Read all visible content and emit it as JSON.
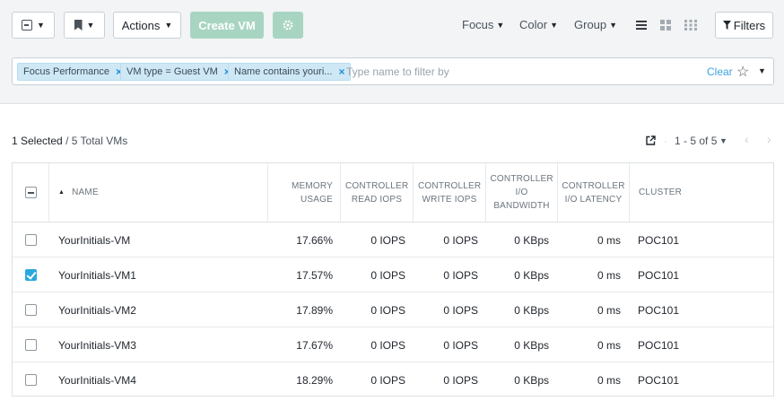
{
  "toolbar": {
    "actions_label": "Actions",
    "create_vm_label": "Create VM",
    "focus_label": "Focus",
    "color_label": "Color",
    "group_label": "Group",
    "filters_label": "Filters"
  },
  "filter_bar": {
    "chips": [
      {
        "label": "Focus Performance"
      },
      {
        "label": "VM type = Guest VM"
      },
      {
        "label": "Name contains youri..."
      }
    ],
    "chip_close": "×",
    "placeholder": "Type name to filter by",
    "clear_label": "Clear"
  },
  "summary": {
    "selected": "1 Selected",
    "total": "/ 5 Total VMs"
  },
  "pagination": {
    "range": "1 - 5 of 5"
  },
  "table": {
    "columns": [
      {
        "label": "NAME",
        "sort": "ascending"
      },
      {
        "label": "MEMORY USAGE"
      },
      {
        "label": "CONTROLLER READ IOPS"
      },
      {
        "label": "CONTROLLER WRITE IOPS"
      },
      {
        "label": "CONTROLLER I/O BANDWIDTH"
      },
      {
        "label": "CONTROLLER I/O LATENCY"
      },
      {
        "label": "CLUSTER"
      }
    ],
    "rows": [
      {
        "checked": false,
        "name": "YourInitials-VM",
        "memory": "17.66%",
        "read_iops": "0 IOPS",
        "write_iops": "0 IOPS",
        "bandwidth": "0 KBps",
        "latency": "0 ms",
        "cluster": "POC101"
      },
      {
        "checked": true,
        "name": "YourInitials-VM1",
        "memory": "17.57%",
        "read_iops": "0 IOPS",
        "write_iops": "0 IOPS",
        "bandwidth": "0 KBps",
        "latency": "0 ms",
        "cluster": "POC101"
      },
      {
        "checked": false,
        "name": "YourInitials-VM2",
        "memory": "17.89%",
        "read_iops": "0 IOPS",
        "write_iops": "0 IOPS",
        "bandwidth": "0 KBps",
        "latency": "0 ms",
        "cluster": "POC101"
      },
      {
        "checked": false,
        "name": "YourInitials-VM3",
        "memory": "17.67%",
        "read_iops": "0 IOPS",
        "write_iops": "0 IOPS",
        "bandwidth": "0 KBps",
        "latency": "0 ms",
        "cluster": "POC101"
      },
      {
        "checked": false,
        "name": "YourInitials-VM4",
        "memory": "18.29%",
        "read_iops": "0 IOPS",
        "write_iops": "0 IOPS",
        "bandwidth": "0 KBps",
        "latency": "0 ms",
        "cluster": "POC101"
      }
    ]
  },
  "colors": {
    "accent": "#2aa8dd",
    "primary_button": "#a8d5c2",
    "chip_bg": "#cfe8f5",
    "link": "#3da2e0"
  },
  "icons": {
    "select_all": "select-dropdown-icon",
    "bookmark": "bookmark-icon",
    "settings": "gear-icon",
    "list_view": "list-view-icon",
    "grid_view": "grid-view-icon",
    "tile_view": "tile-view-icon",
    "filter": "filter-icon",
    "star": "star-icon",
    "export": "export-icon"
  }
}
